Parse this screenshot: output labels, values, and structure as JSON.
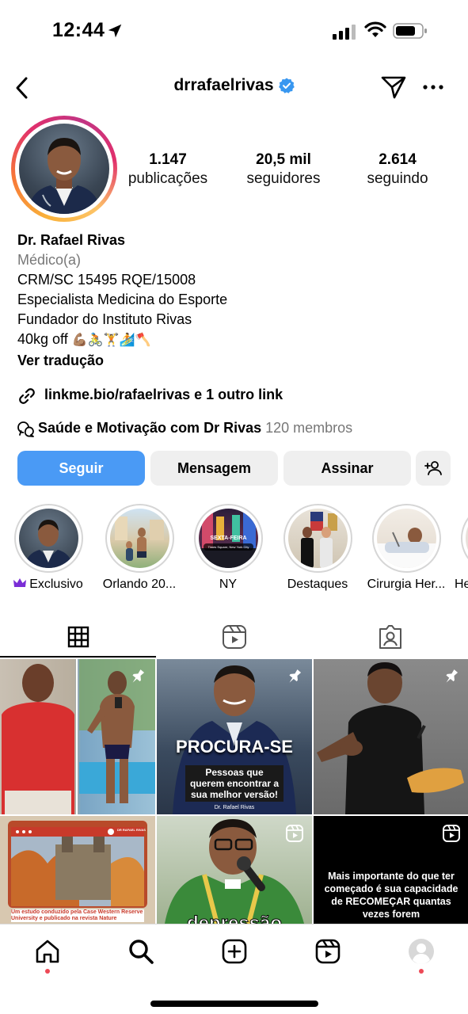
{
  "status_bar": {
    "time": "12:44"
  },
  "header": {
    "username": "drrafaelrivas"
  },
  "stats": {
    "posts_count": "1.147",
    "posts_label": "publicações",
    "followers_count": "20,5 mil",
    "followers_label": "seguidores",
    "following_count": "2.614",
    "following_label": "seguindo"
  },
  "bio": {
    "name": "Dr. Rafael Rivas",
    "category": "Médico(a)",
    "lines": [
      "CRM/SC 15495 RQE/15008",
      "Especialista Medicina do Esporte",
      "Fundador do Instituto Rivas"
    ],
    "weight_line": "40kg off",
    "emojis": [
      "💪🏽",
      "🚴",
      "🏋️",
      "🏄",
      "🪓"
    ],
    "translate": "Ver tradução"
  },
  "link": {
    "text": "linkme.bio/rafaelrivas e 1 outro link"
  },
  "channel": {
    "name": "Saúde e Motivação com Dr Rivas",
    "members": "120 membros"
  },
  "buttons": {
    "follow": "Seguir",
    "message": "Mensagem",
    "subscribe": "Assinar"
  },
  "highlights": [
    {
      "label": "Exclusivo"
    },
    {
      "label": "Orlando 20..."
    },
    {
      "label": "NY"
    },
    {
      "label": "Destaques"
    },
    {
      "label": "Cirurgia Her..."
    },
    {
      "label": "He"
    }
  ],
  "highlight_texts": {
    "ny_sub": "SEXTA-FEIRA",
    "ny_caption": "Times Square, New York City"
  },
  "posts": {
    "p2_title": "PROCURA-SE",
    "p2_sub": "Pessoas que querem encontrar a sua melhor versão!",
    "p2_sig": "Dr. Rafael Rivas",
    "p4_caption": "Um estudo conduzido pela Case Western Reserve University e publicado na revista Nature",
    "p4_brand": "DR RAFAEL RIVAS",
    "p5_word": "depressão",
    "p6_text": "Mais importante do que ter começado é sua capacidade de RECOMEÇAR quantas vezes forem"
  },
  "colors": {
    "follow_blue": "#4a9af5",
    "verified_blue": "#3897f0",
    "notif_red": "#ed4956"
  },
  "icons": [
    "back-icon",
    "verified-icon",
    "send-icon",
    "more-icon",
    "link-icon",
    "channel-icon",
    "add-person-icon",
    "crown-icon",
    "grid-icon",
    "reels-icon",
    "tagged-icon",
    "pin-icon",
    "home-icon",
    "search-icon",
    "create-icon",
    "reels-nav-icon",
    "profile-icon"
  ]
}
